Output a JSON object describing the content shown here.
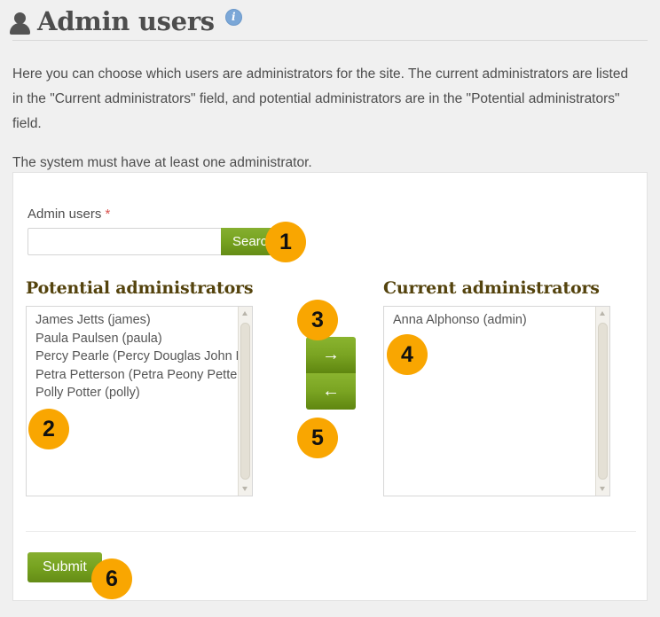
{
  "header": {
    "title": "Admin users",
    "person_icon": "person-icon",
    "info_icon": "info-icon",
    "info_glyph": "i"
  },
  "intro": {
    "paragraph_1": "Here you can choose which users are administrators for the site. The current administrators are listed in the \"Current administrators\" field, and potential administrators are in the \"Potential administrators\" field.",
    "paragraph_2": "The system must have at least one administrator."
  },
  "form": {
    "field_label": "Admin users",
    "required_marker": "*",
    "search": {
      "value": "",
      "placeholder": "",
      "button_label": "Search"
    },
    "potential": {
      "heading": "Potential administrators",
      "items": [
        "James Jetts (james)",
        "Paula Paulsen (paula)",
        "Percy Pearle (Percy Douglas John Pearle)",
        "Petra Petterson (Petra Peony Petterson)",
        "Polly Potter (polly)"
      ]
    },
    "current": {
      "heading": "Current administrators",
      "items": [
        "Anna Alphonso (admin)"
      ]
    },
    "transfer": {
      "add_glyph": "→",
      "remove_glyph": "←"
    },
    "submit_label": "Submit"
  },
  "badges": {
    "b1": "1",
    "b2": "2",
    "b3": "3",
    "b4": "4",
    "b5": "5",
    "b6": "6"
  },
  "colors": {
    "page_background": "#f0f0f0",
    "panel_background": "#ffffff",
    "green_button": "#77a320",
    "badge_orange": "#f9a601",
    "heading_brown": "#54430d",
    "required_red": "#d9534f",
    "info_blue": "#7ba7d7"
  }
}
